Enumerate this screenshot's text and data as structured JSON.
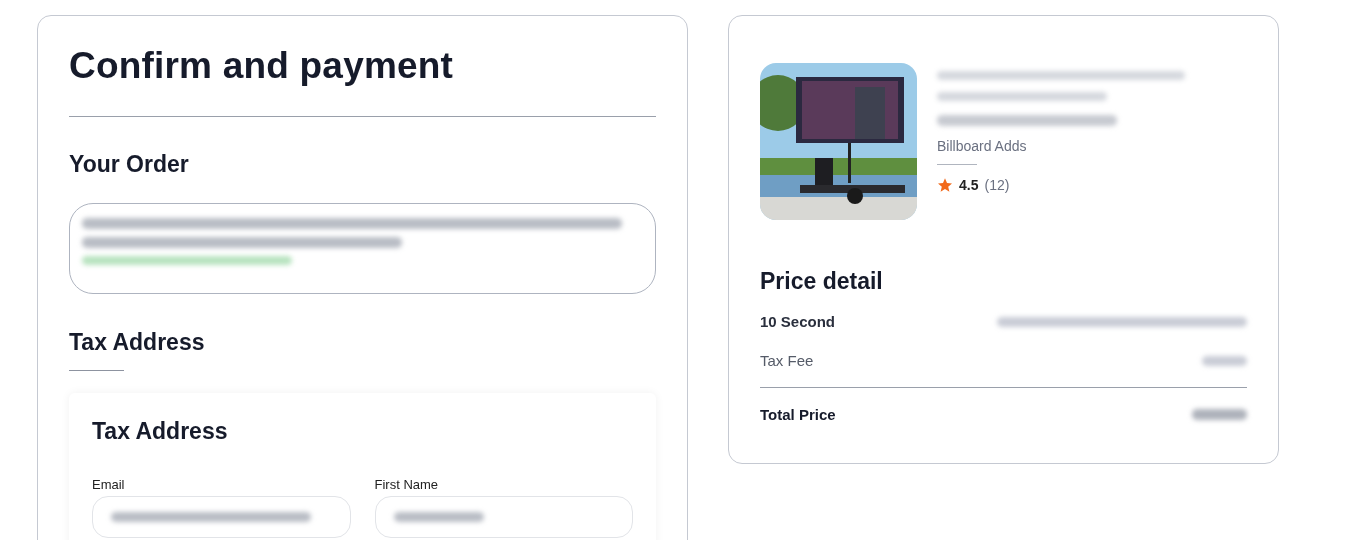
{
  "checkout": {
    "title": "Confirm and payment",
    "order_heading": "Your Order",
    "tax_heading": "Tax Address",
    "form": {
      "title": "Tax Address",
      "fields": [
        {
          "label": "Email"
        },
        {
          "label": "First Name"
        }
      ]
    }
  },
  "summary": {
    "listing": {
      "kind": "picture",
      "category": "Billboard Adds",
      "rating": "4.5",
      "reviews": "(12)"
    },
    "price_heading": "Price detail",
    "lines": [
      {
        "label": "10 Second",
        "kind": "bold"
      },
      {
        "label": "Tax Fee",
        "kind": "plain"
      }
    ],
    "total_label": "Total Price"
  }
}
